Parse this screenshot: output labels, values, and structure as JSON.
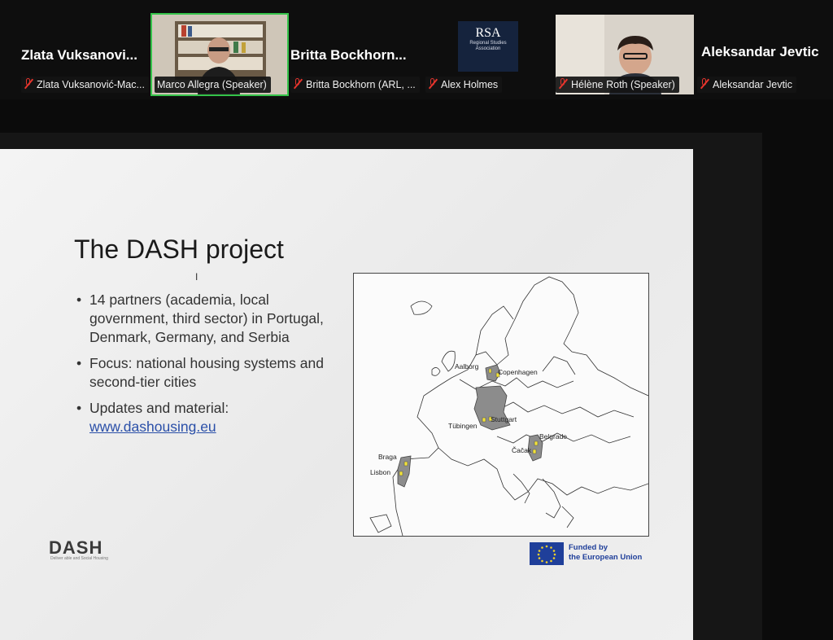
{
  "participants": [
    {
      "display_name": "Zlata Vuksanovi...",
      "caption": "Zlata Vuksanović-Mac..."
    },
    {
      "caption": "Marco Allegra (Speaker)"
    },
    {
      "display_name": "Britta Bockhorn...",
      "caption": "Britta Bockhorn (ARL, ..."
    },
    {
      "caption": "Alex Holmes",
      "logo_text": "RSA",
      "logo_sub": "Regional Studies Association"
    },
    {
      "caption": "Hélène Roth (Speaker)"
    },
    {
      "display_name": "Aleksandar Jevtic",
      "caption": "Aleksandar Jevtic"
    }
  ],
  "slide": {
    "title": "The DASH project",
    "bullets": [
      "14 partners (academia, local government, third sector) in Portugal, Denmark, Germany, and Serbia",
      "Focus: national housing systems and second-tier cities",
      "Updates and material:"
    ],
    "link": "www.dashousing.eu",
    "map_cities": [
      "Aalborg",
      "Copenhagen",
      "Stuttgart",
      "Tübingen",
      "Belgrade",
      "Čačak",
      "Braga",
      "Lisbon"
    ],
    "logo": "DASH",
    "logo_sub": "Deliver able and Social Housing",
    "funding_line1": "Funded by",
    "funding_line2": "the European Union"
  },
  "colors": {
    "active_speaker_border": "#35c34a",
    "muted_icon": "#e5342c",
    "map_highlight": "#8c8c8c",
    "marker": "#f2e23a"
  }
}
